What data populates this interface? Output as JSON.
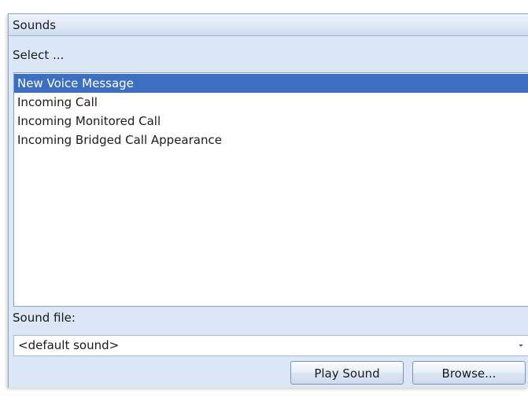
{
  "panel": {
    "title": "Sounds"
  },
  "select_label": "Select ...",
  "events": [
    {
      "label": "New Voice Message",
      "selected": true
    },
    {
      "label": "Incoming Call",
      "selected": false
    },
    {
      "label": "Incoming Monitored Call",
      "selected": false
    },
    {
      "label": "Incoming Bridged Call Appearance",
      "selected": false
    }
  ],
  "sound_file": {
    "label": "Sound file:",
    "value": "<default sound>"
  },
  "buttons": {
    "play": "Play Sound",
    "browse": "Browse..."
  },
  "colors": {
    "selection": "#3d6fc1",
    "panel_bg": "#dbe7f6",
    "header_bg": "#dce8f7"
  },
  "icons": {
    "combo_dropdown": "chevron-down-icon"
  }
}
